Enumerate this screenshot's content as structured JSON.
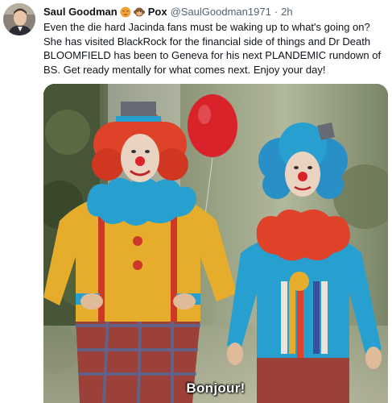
{
  "tweet": {
    "author_name": "Saul Goodman",
    "emoji_1": "tired-face-emoji",
    "emoji_2": "monkey-emoji",
    "name_suffix": "Pox",
    "handle": "@SaulGoodman1971",
    "separator": "·",
    "timestamp": "2h",
    "text": "Even the die hard Jacinda fans must be waking up to what's going on? She has visited BlackRock for the financial side of things and Dr Death BLOOMFIELD has been to Geneva for his next PLANDEMIC rundown of BS. Get ready mentally for what comes next. Enjoy your day!",
    "media": {
      "caption": "Bonjour!",
      "description_icon": "clowns-video-still"
    }
  },
  "colors": {
    "handle_gray": "#536471",
    "text_black": "#0f1419",
    "clown_wig_red": "#e8452a",
    "clown_collar_blue": "#2aa7d8",
    "balloon_red": "#e2242b"
  }
}
